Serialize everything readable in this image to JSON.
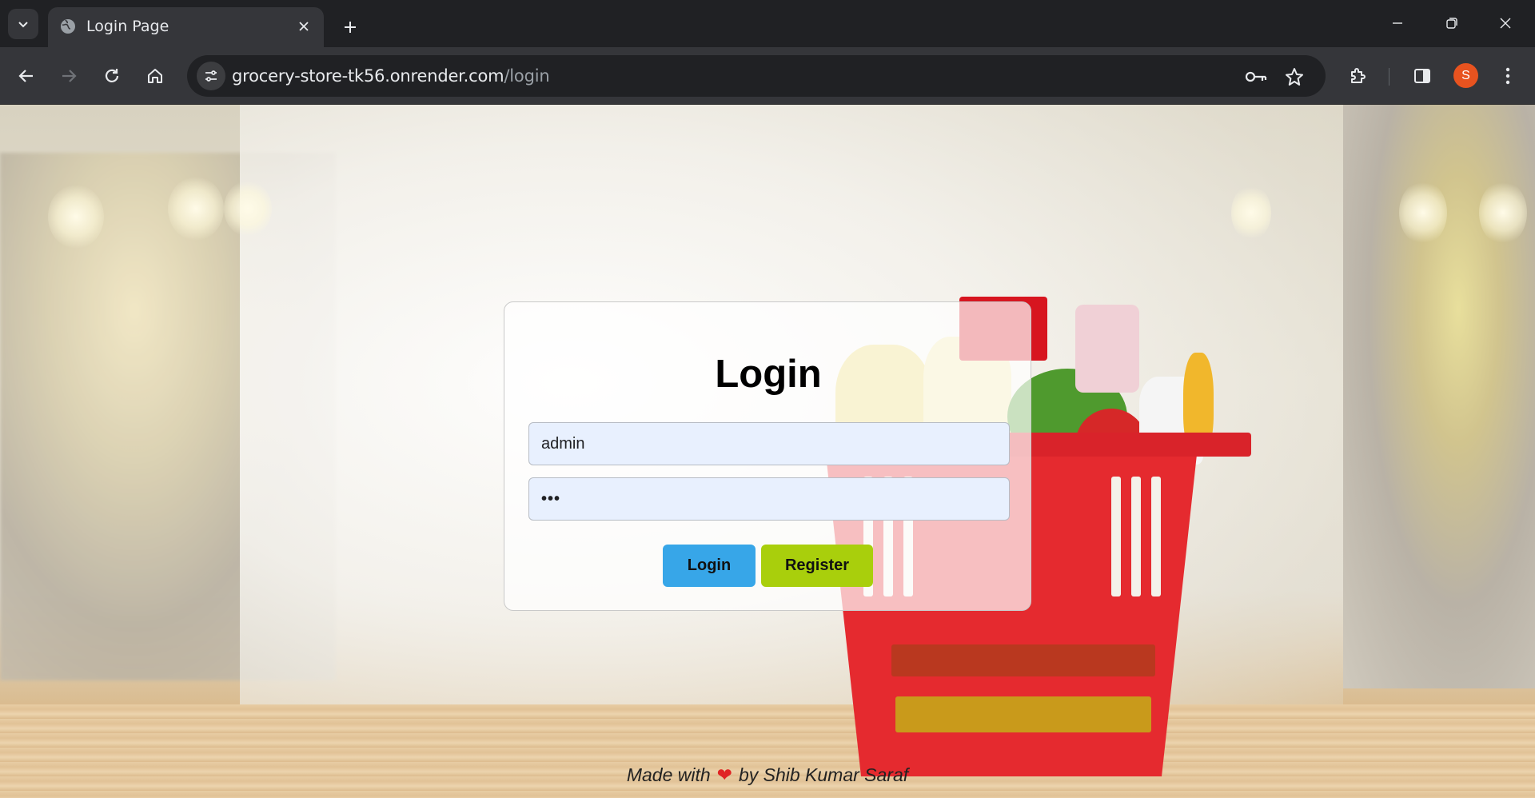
{
  "browser": {
    "tab_title": "Login Page",
    "url_host": "grocery-store-tk56.onrender.com",
    "url_path": "/login",
    "profile_initial": "S",
    "icons": {
      "tab_search": "chevron-down-icon",
      "favicon": "globe-icon",
      "tab_close": "close-icon",
      "new_tab": "plus-icon",
      "minimize": "minimize-icon",
      "restore": "restore-icon",
      "close": "close-icon",
      "back": "back-arrow-icon",
      "forward": "forward-arrow-icon",
      "reload": "reload-icon",
      "home": "home-icon",
      "site_info": "tune-icon",
      "password": "key-icon",
      "bookmark": "star-icon",
      "extensions": "puzzle-icon",
      "side_panel": "side-panel-icon",
      "menu": "kebab-menu-icon"
    }
  },
  "login": {
    "title": "Login",
    "username_value": "admin",
    "password_value": "•••",
    "login_button": "Login",
    "register_button": "Register"
  },
  "footer": {
    "made_with": "Made with",
    "by": "by Shib Kumar Saraf"
  },
  "colors": {
    "login_button": "#37a6e8",
    "register_button": "#a9cf0c",
    "input_bg": "#e8f0fe",
    "avatar": "#e8531f",
    "heart": "#e02424"
  }
}
